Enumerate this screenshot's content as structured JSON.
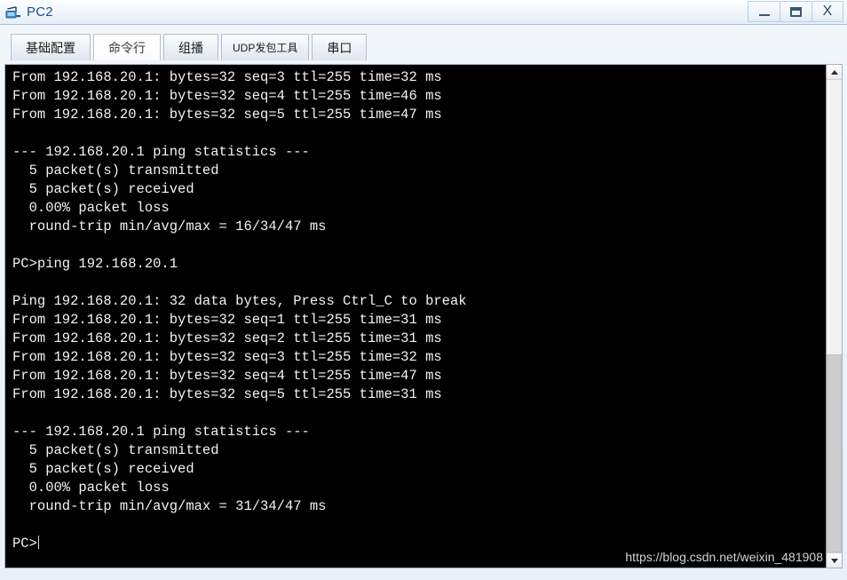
{
  "window": {
    "title": "PC2",
    "icon": "pc-device-icon",
    "controls": {
      "minimize_label": "–",
      "maximize_label": "❐",
      "close_label": "X",
      "minimize_name": "minimize",
      "maximize_name": "maximize",
      "close_name": "close"
    }
  },
  "tabs": [
    {
      "label": "基础配置",
      "name": "tab-basic-config",
      "selected": false,
      "small": false
    },
    {
      "label": "命令行",
      "name": "tab-command-line",
      "selected": true,
      "small": false
    },
    {
      "label": "组播",
      "name": "tab-multicast",
      "selected": false,
      "small": false
    },
    {
      "label": "UDP发包工具",
      "name": "tab-udp-tool",
      "selected": false,
      "small": true
    },
    {
      "label": "串口",
      "name": "tab-serial-port",
      "selected": false,
      "small": false
    }
  ],
  "terminal": {
    "prompt": "PC>",
    "lines": [
      "From 192.168.20.1: bytes=32 seq=3 ttl=255 time=32 ms",
      "From 192.168.20.1: bytes=32 seq=4 ttl=255 time=46 ms",
      "From 192.168.20.1: bytes=32 seq=5 ttl=255 time=47 ms",
      "",
      "--- 192.168.20.1 ping statistics ---",
      "  5 packet(s) transmitted",
      "  5 packet(s) received",
      "  0.00% packet loss",
      "  round-trip min/avg/max = 16/34/47 ms",
      "",
      "PC>ping 192.168.20.1",
      "",
      "Ping 192.168.20.1: 32 data bytes, Press Ctrl_C to break",
      "From 192.168.20.1: bytes=32 seq=1 ttl=255 time=31 ms",
      "From 192.168.20.1: bytes=32 seq=2 ttl=255 time=31 ms",
      "From 192.168.20.1: bytes=32 seq=3 ttl=255 time=32 ms",
      "From 192.168.20.1: bytes=32 seq=4 ttl=255 time=47 ms",
      "From 192.168.20.1: bytes=32 seq=5 ttl=255 time=31 ms",
      "",
      "--- 192.168.20.1 ping statistics ---",
      "  5 packet(s) transmitted",
      "  5 packet(s) received",
      "  0.00% packet loss",
      "  round-trip min/avg/max = 31/34/47 ms",
      "",
      ""
    ]
  },
  "watermark": {
    "text": "https://blog.csdn.net/weixin_481908"
  },
  "scrollbar": {
    "up_arrow": "scroll-up-arrow",
    "down_arrow": "scroll-down-arrow",
    "thumb_top_percent": 58
  },
  "colors": {
    "terminal_bg": "#000000",
    "terminal_fg": "#f2f2f2",
    "title_fg": "#1d4f86",
    "chrome": "#eaf0f8"
  }
}
